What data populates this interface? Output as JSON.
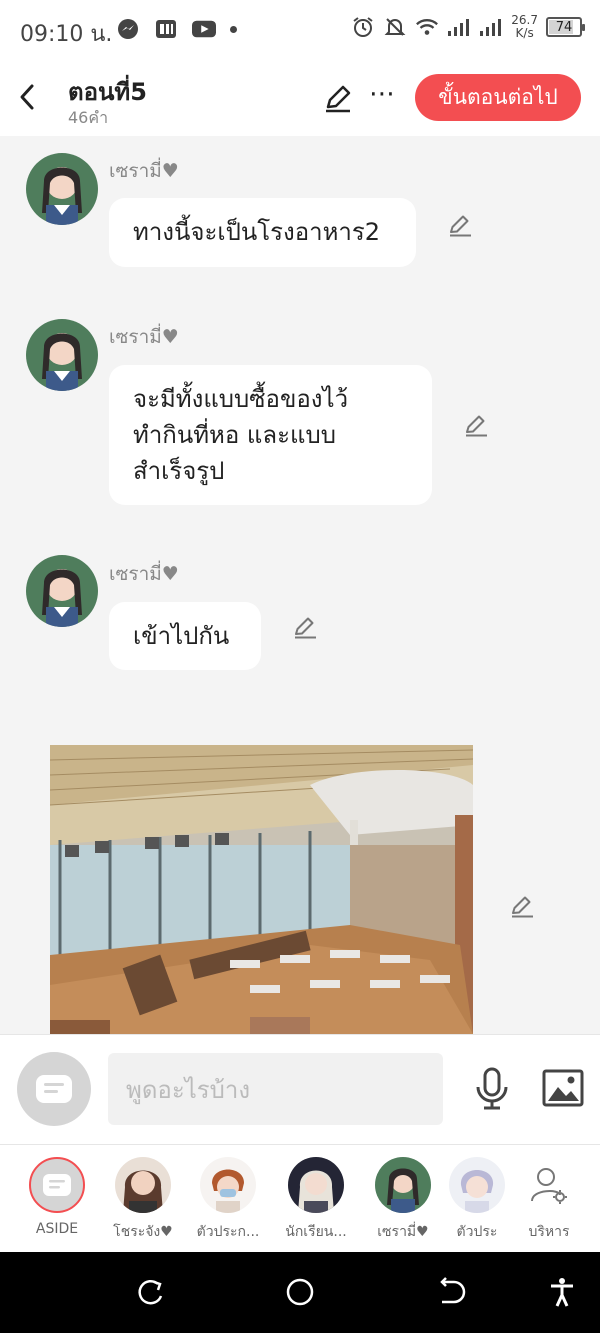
{
  "status_bar": {
    "time": "09:10 น.",
    "speed_value": "26.7",
    "speed_unit": "K/s",
    "battery": "74",
    "battery_level": 0.74,
    "left_icons": [
      "messenger-icon",
      "app-icon",
      "youtube-icon",
      "dot-icon"
    ],
    "right_icons": [
      "alarm-icon",
      "mute-icon",
      "wifi-icon",
      "signal-icon",
      "signal-icon",
      "battery-icon"
    ]
  },
  "header": {
    "title": "ตอนที่5",
    "word_count": "46คำ",
    "next_button": "ขั้นตอนต่อไป"
  },
  "messages": [
    {
      "sender": "เซรามี่♥",
      "lines": [
        "ทางนี้จะเป็นโรงอาหาร2"
      ]
    },
    {
      "sender": "เซรามี่♥",
      "lines": [
        "จะมีทั้งแบบซื้อของไว้",
        "ทำกินที่หอ และแบบ",
        "สำเร็จรูป"
      ]
    },
    {
      "sender": "เซรามี่♥",
      "lines": [
        "เข้าไปกัน"
      ]
    }
  ],
  "composer": {
    "placeholder": "พูดอะไรบ้าง"
  },
  "characters": [
    {
      "name": "ASIDE",
      "icon": "chat-bubble-icon"
    },
    {
      "name": "โชระจัง♥"
    },
    {
      "name": "ตัวประก..."
    },
    {
      "name": "นักเรียน..."
    },
    {
      "name": "เซรามี่♥"
    },
    {
      "name": "ตัวประ"
    },
    {
      "name": "บริหาร",
      "icon": "user-settings-icon"
    }
  ],
  "colors": {
    "accent": "#f34e51",
    "background": "#f4f4f4"
  }
}
